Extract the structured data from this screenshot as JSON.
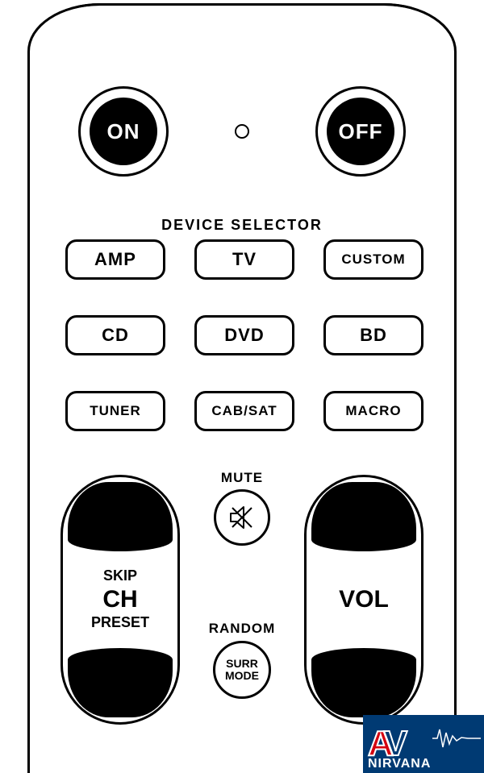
{
  "power": {
    "on": "ON",
    "off": "OFF"
  },
  "device_selector": {
    "title": "DEVICE SELECTOR",
    "buttons": [
      "AMP",
      "TV",
      "CUSTOM",
      "CD",
      "DVD",
      "BD",
      "TUNER",
      "CAB/SAT",
      "MACRO"
    ]
  },
  "mute": {
    "label": "MUTE"
  },
  "random": {
    "label": "RANDOM",
    "button": "SURR\nMODE"
  },
  "rocker_left": {
    "l1": "SKIP",
    "l2": "CH",
    "l3": "PRESET"
  },
  "rocker_right": {
    "l2": "VOL"
  },
  "watermark": {
    "a": "A",
    "v": "V",
    "text": "NIRVANA"
  }
}
